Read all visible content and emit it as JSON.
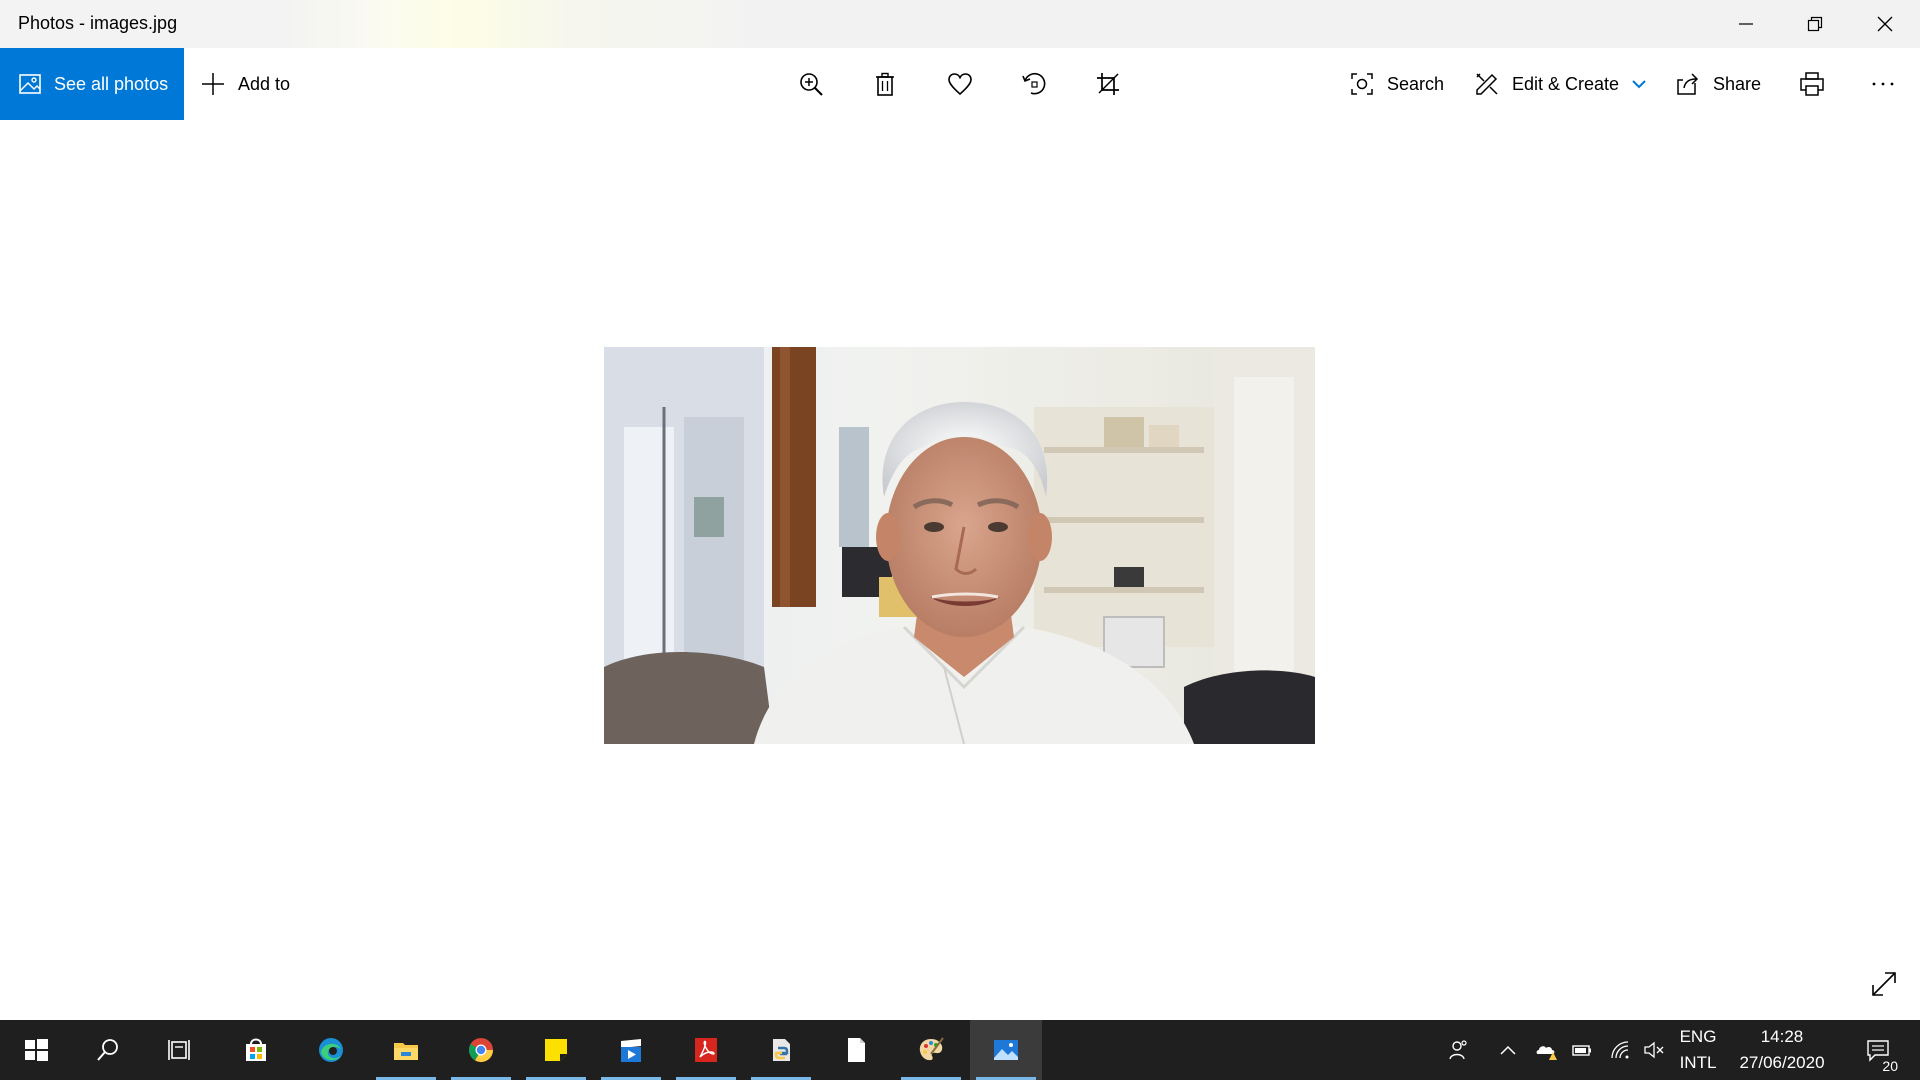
{
  "window": {
    "title": "Photos - images.jpg",
    "controls": [
      "minimize-icon",
      "restore-icon",
      "close-icon"
    ]
  },
  "toolbar": {
    "see_all_label": "See all photos",
    "add_to_label": "Add to",
    "search_label": "Search",
    "edit_create_label": "Edit & Create",
    "share_label": "Share",
    "icons": [
      "zoom-in-icon",
      "delete-icon",
      "favorite-icon",
      "rotate-icon",
      "crop-icon",
      "print-icon",
      "more-icon"
    ],
    "accent": "#0078d7"
  },
  "photo": {
    "subject": "man-with-white-hair-portrait"
  },
  "taskbar": {
    "apps": [
      "windows-start-icon",
      "search-icon",
      "task-view-icon",
      "microsoft-store-icon",
      "edge-icon",
      "file-explorer-icon",
      "chrome-icon",
      "sticky-notes-icon",
      "movies-tv-icon",
      "acrobat-icon",
      "python-icon",
      "blank-document-icon",
      "paint-icon",
      "photos-icon"
    ],
    "language": "ENG",
    "layout": "INTL",
    "time": "14:28",
    "date": "27/06/2020",
    "notification_count": "20"
  }
}
